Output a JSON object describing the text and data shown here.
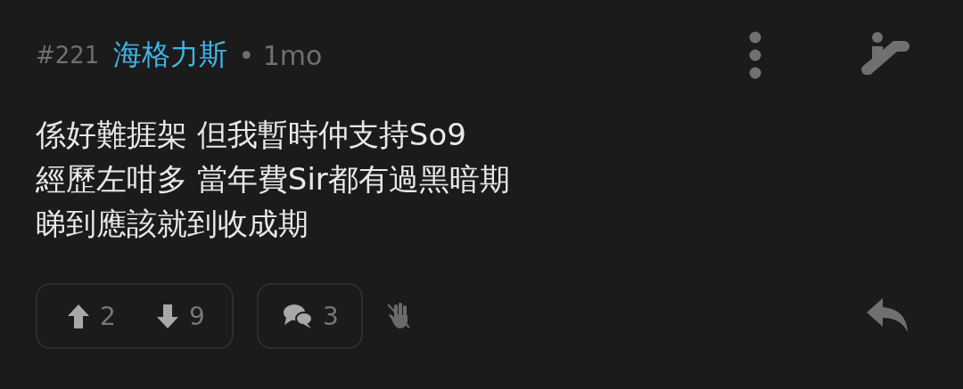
{
  "comment": {
    "number": "#221",
    "author": "海格力斯",
    "separator": "•",
    "age": "1mo",
    "lines": [
      "係好難捱架 但我暫時仲支持So9",
      "經歷左咁多 當年費Sir都有過黑暗期",
      "睇到應該就到收成期"
    ]
  },
  "actions": {
    "upvotes": "2",
    "downvotes": "9",
    "replies": "3"
  }
}
